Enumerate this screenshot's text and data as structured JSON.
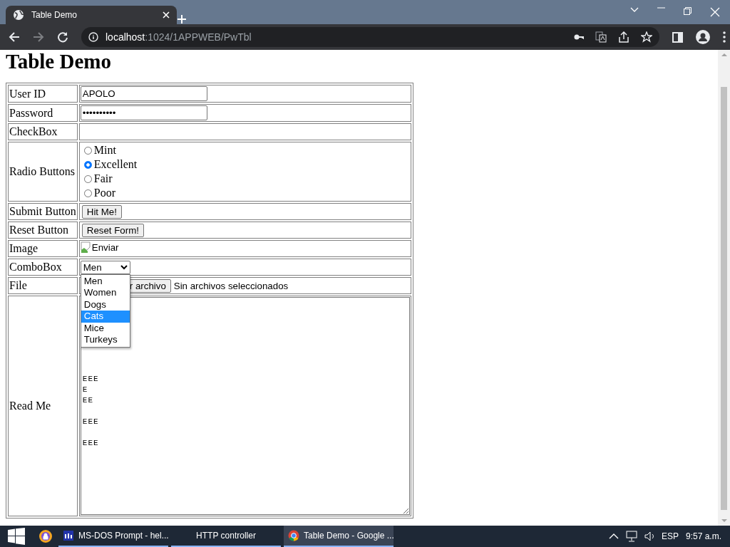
{
  "browser": {
    "tab": {
      "title": "Table Demo",
      "selected": true
    },
    "nav": {
      "forward_disabled": true
    },
    "address": {
      "host": "localhost",
      "path": ":1024/1APPWEB/PwTbl"
    }
  },
  "page": {
    "heading": "Table Demo",
    "rows": [
      {
        "kind": "text",
        "label": "User ID",
        "value": "APOLO"
      },
      {
        "kind": "text",
        "label": "Password",
        "value": "••••••••••"
      },
      {
        "kind": "empty",
        "label": "CheckBox"
      },
      {
        "kind": "radio",
        "label": "Radio Buttons",
        "options": [
          {
            "label": "Mint",
            "selected": false
          },
          {
            "label": "Excellent",
            "selected": true
          },
          {
            "label": "Fair",
            "selected": false
          },
          {
            "label": "Poor",
            "selected": false
          }
        ]
      },
      {
        "kind": "button",
        "label": "Submit Button",
        "button": "Hit Me!"
      },
      {
        "kind": "button",
        "label": "Reset Button",
        "button": "Reset Form!"
      },
      {
        "kind": "image",
        "label": "Image",
        "alt": "Enviar"
      },
      {
        "kind": "select",
        "label": "ComboBox",
        "value": "Men",
        "open": true,
        "options": [
          {
            "label": "Men",
            "highlighted": false
          },
          {
            "label": "Women",
            "highlighted": false
          },
          {
            "label": "Dogs",
            "highlighted": false
          },
          {
            "label": "Cats",
            "highlighted": true
          },
          {
            "label": "Mice",
            "highlighted": false
          },
          {
            "label": "Turkeys",
            "highlighted": false
          }
        ]
      },
      {
        "kind": "file",
        "label": "File",
        "button": "r archivo",
        "status": "Sin archivos seleccionados"
      },
      {
        "kind": "textarea",
        "label": "Read Me",
        "value": "\n\n\n\n\n\n\nEEE\nE\nEE\n\nEEE\n\nEEE"
      }
    ]
  },
  "taskbar": {
    "items": [
      {
        "label": "MS-DOS Prompt - hel...",
        "selected": false
      },
      {
        "label": "HTTP controller",
        "selected": false
      },
      {
        "label": "Table Demo - Google ...",
        "selected": true
      }
    ],
    "language": "ESP",
    "time": "9:57 a.m."
  }
}
